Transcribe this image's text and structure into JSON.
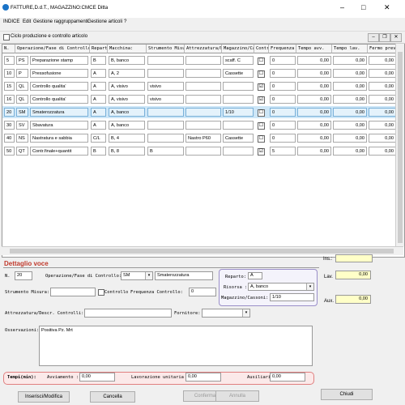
{
  "window": {
    "title": "FATTURE,D.d.T., MAGAZZINO:CMCE Ditta",
    "min": "–",
    "max": "□",
    "close": "✕"
  },
  "menu": [
    "INDICE",
    "Edit",
    "Gestione raggruppamenti",
    "Gestione articoli",
    "?"
  ],
  "child": {
    "title": "Ciclo produzione e controllo articolo",
    "min": "–",
    "restore": "❐",
    "close": "✕"
  },
  "grid": {
    "columns": [
      "N.",
      "Operazione/Fase di Controllo",
      "Reparto",
      "Macchina:",
      "Strumento Misura",
      "Attrezzatura/Desc",
      "Magazzino/Cas",
      "Contr",
      "Frequenza",
      "Tempo avv.",
      "Tempo lav.",
      "Fermo prev."
    ],
    "rows": [
      {
        "n": "5",
        "code": "PS",
        "op": "Preparazione stamp",
        "rep": "B",
        "mac": "B, banco",
        "str": "",
        "att": "",
        "mag": "scaff. C",
        "ctl": "☐",
        "freq": "0",
        "avv": "0,00",
        "lav": "0,00",
        "fer": "0,00"
      },
      {
        "n": "10",
        "code": "P",
        "op": "Pressofusione",
        "rep": "A",
        "mac": "A, 2",
        "str": "",
        "att": "",
        "mag": "Cassette",
        "ctl": "☐",
        "freq": "0",
        "avv": "0,00",
        "lav": "0,00",
        "fer": "0,00"
      },
      {
        "n": "15",
        "code": "QL",
        "op": "Controllo qualita'",
        "rep": "A",
        "mac": "A, visivo",
        "str": "visivo",
        "att": "",
        "mag": "",
        "ctl": "☑",
        "freq": "0",
        "avv": "0,00",
        "lav": "0,00",
        "fer": "0,00"
      },
      {
        "n": "16",
        "code": "QL",
        "op": "Controllo qualita'",
        "rep": "A",
        "mac": "A, visivo",
        "str": "visivo",
        "att": "",
        "mag": "",
        "ctl": "☑",
        "freq": "0",
        "avv": "0,00",
        "lav": "0,00",
        "fer": "0,00"
      },
      {
        "n": "20",
        "code": "SM",
        "op": "Smaterozzatura",
        "rep": "A",
        "mac": "A, banco",
        "str": "",
        "att": "",
        "mag": "1/10",
        "ctl": "☐",
        "freq": "0",
        "avv": "0,00",
        "lav": "0,00",
        "fer": "0,00"
      },
      {
        "n": "30",
        "code": "SV",
        "op": "Sbavatura",
        "rep": "A",
        "mac": "A, banco",
        "str": "",
        "att": "",
        "mag": "",
        "ctl": "☐",
        "freq": "0",
        "avv": "0,00",
        "lav": "0,00",
        "fer": "0,00"
      },
      {
        "n": "40",
        "code": "NS",
        "op": "Nastratura e sabbia",
        "rep": "C/L",
        "mac": "B, 4",
        "str": "",
        "att": "Nastro P60",
        "mag": "Cassette",
        "ctl": "☐",
        "freq": "0",
        "avv": "0,00",
        "lav": "0,00",
        "fer": "0,00"
      },
      {
        "n": "50",
        "code": "QT",
        "op": "Contr.finale+quantit",
        "rep": "B",
        "mac": "B, 8",
        "str": "B",
        "att": "",
        "mag": "",
        "ctl": "☑",
        "freq": "5",
        "avv": "0,00",
        "lav": "0,00",
        "fer": "0,00"
      }
    ]
  },
  "right": {
    "top_label": "Ins.:",
    "lav_label": "Lav.",
    "lav_value": "0,00",
    "aux_label": "Aux.",
    "aux_value": "0,00"
  },
  "detail": {
    "title": "Dettaglio voce",
    "n_label": "N.",
    "n_value": "20",
    "op_label": "Operazione/Fase di Controllo:",
    "op_code": "SM",
    "op_desc": "Smaterozzatura",
    "reparto_label": "Reparto:",
    "reparto_value": "A",
    "risorsa_label": "Risorsa :",
    "risorsa_value": "A, banco",
    "mag_label": "Magazzino/Cassoni:",
    "mag_value": "1/10",
    "strumento_label": "Strumento Misura:",
    "strumento_value": "",
    "controllo_label": "Controllo",
    "freq_label": "Frequenza Controllo:",
    "freq_value": "0",
    "attr_label": "Attrezzatura/Descr. Controlli:",
    "attr_value": "",
    "fornitore_label": "Fornitore:",
    "fornitore_value": "",
    "oss_label": "Osservazioni:",
    "oss_value": "Positiva Pz. Mrt"
  },
  "tempi": {
    "label": "Tempi(min):",
    "avv_label": "Avviamento :",
    "avv_value": "0,00",
    "lav_label": "Lavorazione unitaria",
    "lav_value": "0,00",
    "aus_label": "Ausiliario",
    "aus_value": "0,00"
  },
  "buttons": {
    "insert": "Inserisci/Modifica",
    "cancel": "Cancella",
    "confirm": "Conferma",
    "cancel2": "Annulla",
    "close": "Chiudi"
  }
}
